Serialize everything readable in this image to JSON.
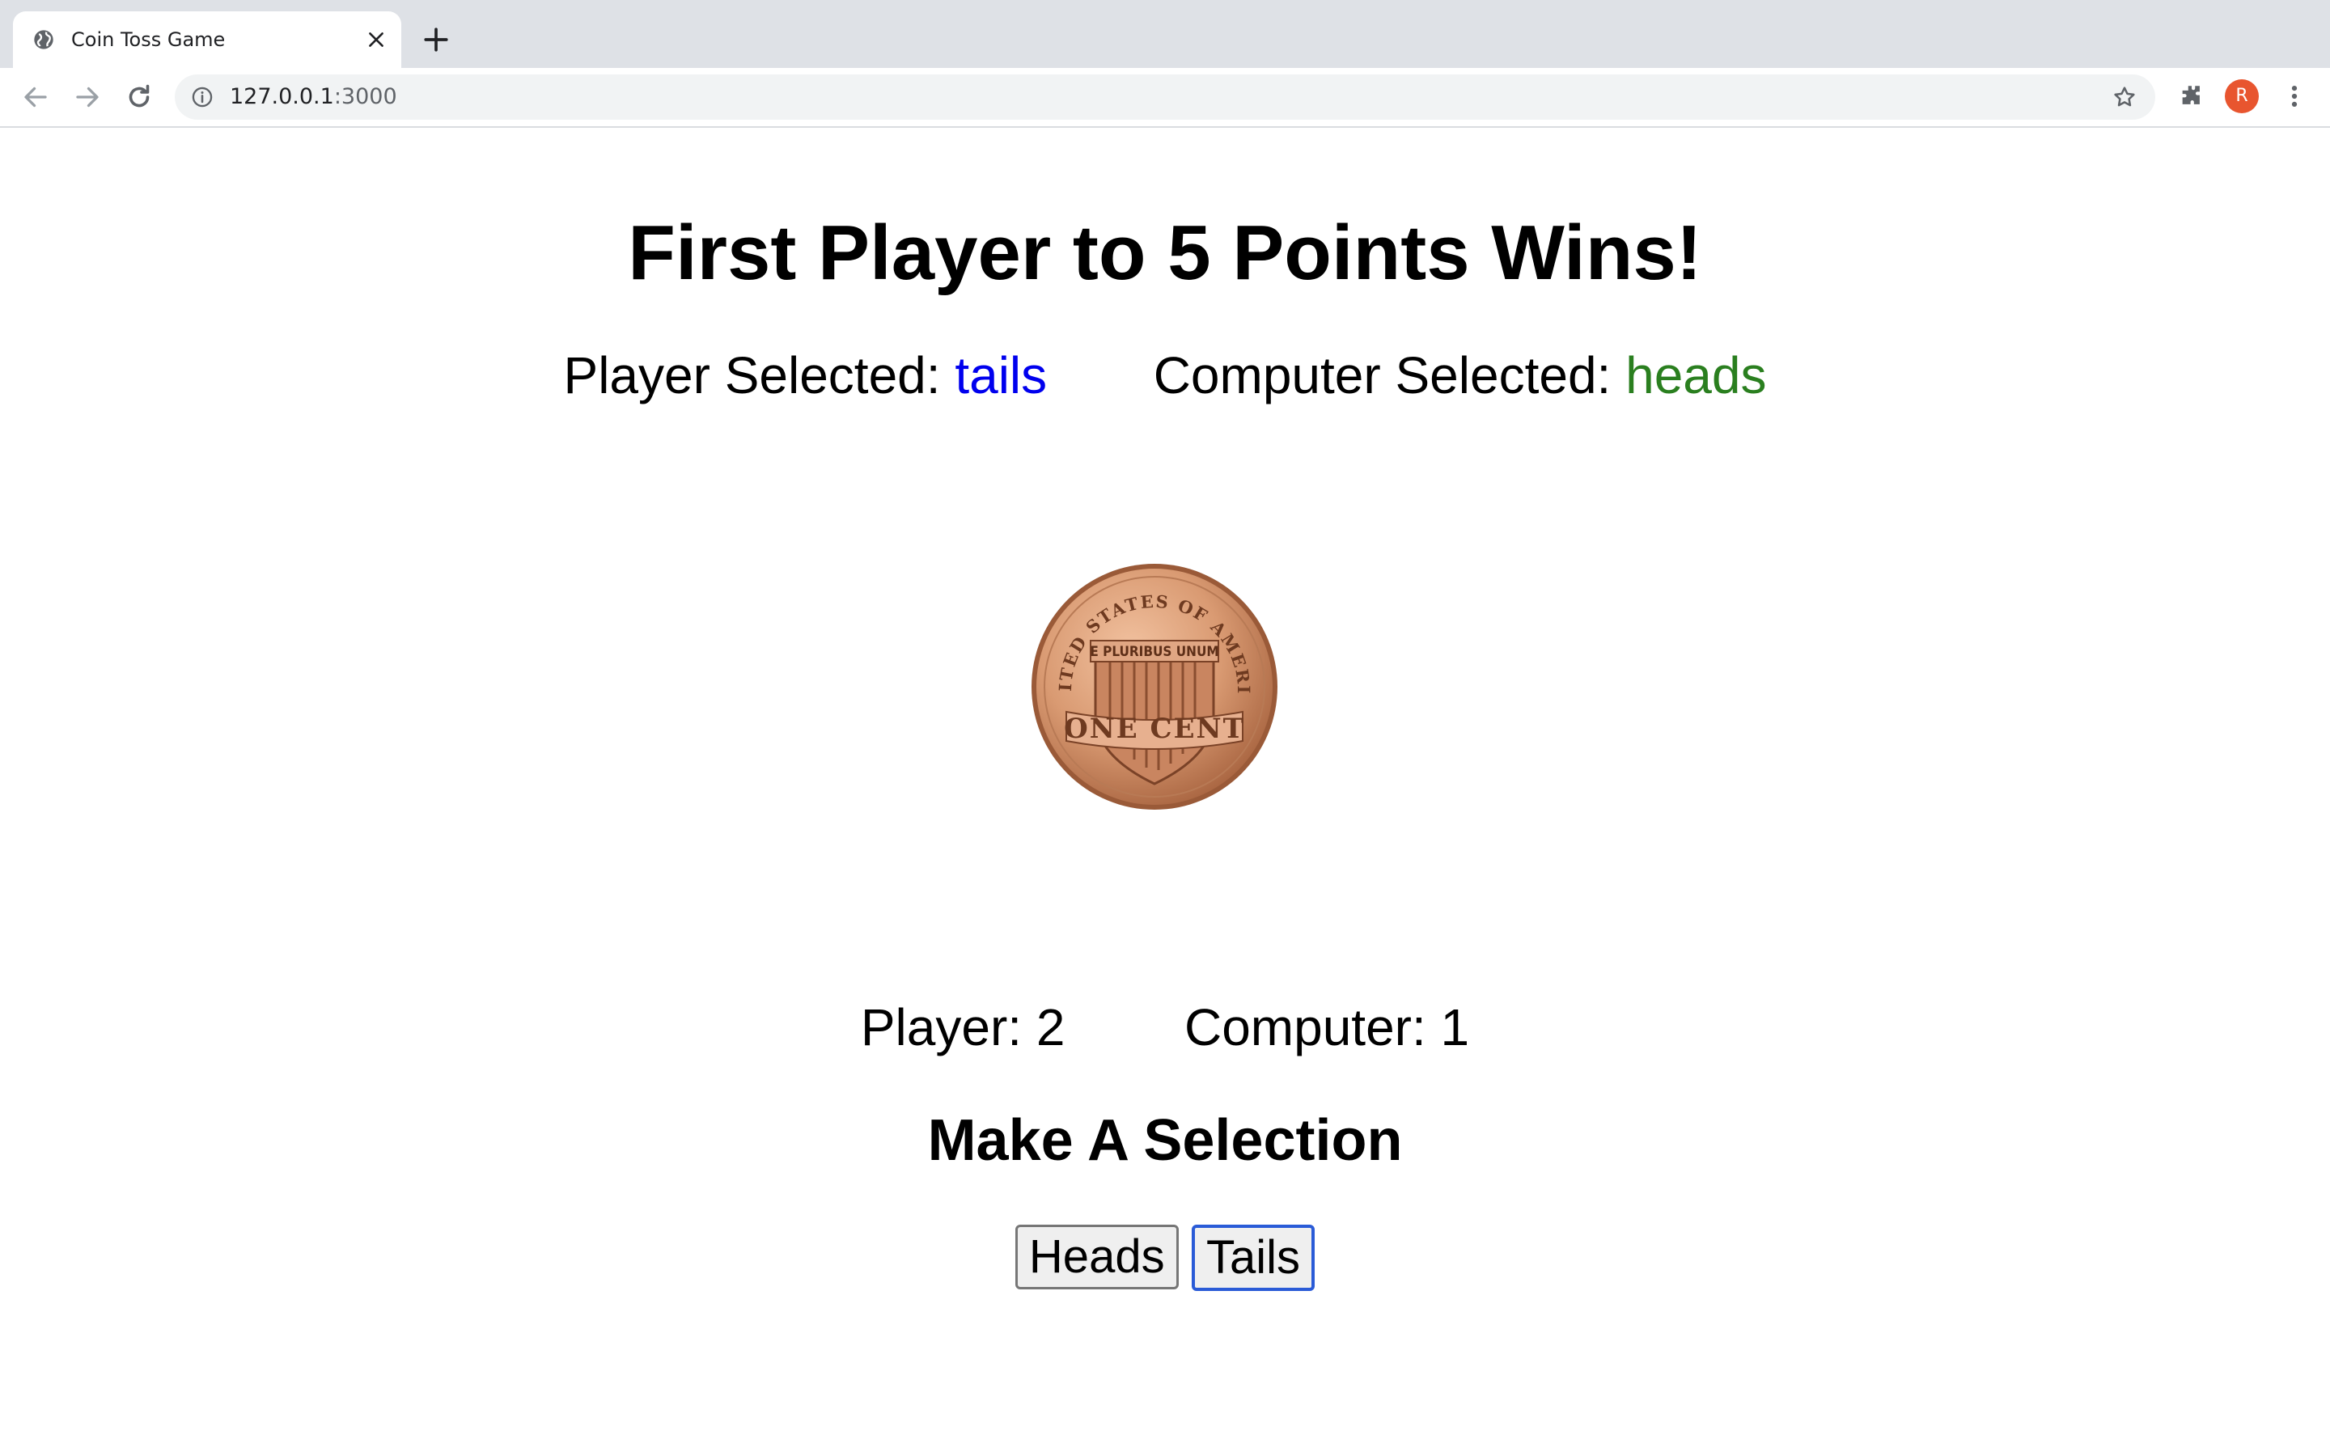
{
  "browser": {
    "tab_title": "Coin Toss Game",
    "url_host": "127.0.0.1",
    "url_port": ":3000",
    "avatar_initial": "R",
    "icons": [
      "globe-icon",
      "close-icon",
      "plus-icon",
      "back-arrow-icon",
      "forward-arrow-icon",
      "reload-icon",
      "info-icon",
      "star-icon",
      "puzzle-icon",
      "more-vert-icon"
    ]
  },
  "game": {
    "heading": "First Player to 5 Points Wins!",
    "player_selected_label": "Player Selected:",
    "player_selected_value": "tails",
    "computer_selected_label": "Computer Selected:",
    "computer_selected_value": "heads",
    "coin_texts": [
      "UNITED STATES OF AMERICA",
      "E PLURIBUS UNUM",
      "ONE CENT"
    ],
    "player_score_label": "Player:",
    "player_score": "2",
    "computer_score_label": "Computer:",
    "computer_score": "1",
    "prompt": "Make A Selection",
    "heads_button": "Heads",
    "tails_button": "Tails"
  },
  "colors": {
    "player_selection": "#0000ee",
    "computer_selection": "#2a7f1f",
    "coin_copper": "#d99a72",
    "avatar": "#e8552f",
    "focus_ring": "#2a5bd7"
  }
}
